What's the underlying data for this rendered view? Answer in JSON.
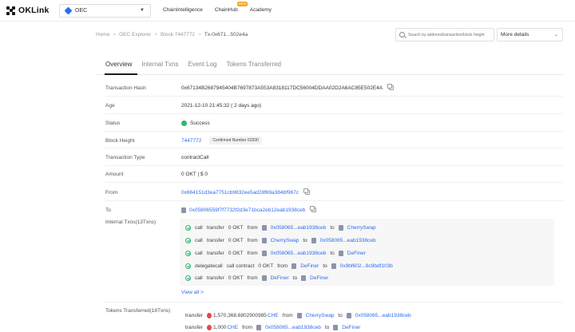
{
  "header": {
    "logo_text": "OKLink",
    "chain": "OEC",
    "nav": [
      {
        "label": "ChainIntelligence"
      },
      {
        "label": "ChainHub",
        "badge": "NEW"
      },
      {
        "label": "Academy"
      }
    ]
  },
  "breadcrumb": [
    "Home",
    "OEC Explorer",
    "Block 7447772",
    "Tx-0x671...502e4a"
  ],
  "search": {
    "placeholder": "Search by address/transaction/block height"
  },
  "more_details": "More details",
  "tabs": [
    "Overview",
    "Internal Txns",
    "Event Log",
    "Tokens Transferred"
  ],
  "details": {
    "hash_label": "Transaction Hash",
    "hash": "0x67134B2687945404B7697873A553A8318117DC56004DDAA02D2A6AC85E502E4A",
    "age_label": "Age",
    "age": "2021-12-10 21:45:32 ( 2 days ago)",
    "status_label": "Status",
    "status": "Success",
    "block_label": "Block Height",
    "block": "7447772",
    "confirm": "Confirmed Number 63200",
    "type_label": "Transaction Type",
    "type": "contractCall",
    "amount_label": "Amount",
    "amount": "0 OKT | $ 0",
    "from_label": "From",
    "from": "0x664151d3ea7751cb9832ee5ad28f69a384bf967c",
    "to_label": "To",
    "to": "0x05806559f7f7732f2d3e71bca2eb12eab1938ceb",
    "itx_label": "Internal Txns(13Txns)",
    "tt_label": "Tokens Transferred(18Txns)"
  },
  "internal_txns": [
    {
      "type": "call",
      "mid": "transfer",
      "amount": "0 OKT",
      "from_w": "from",
      "from": "0x058065...eab1938ceb",
      "to_w": "to",
      "to": "CherrySwap"
    },
    {
      "type": "call",
      "mid": "transfer",
      "amount": "0 OKT",
      "from_w": "from",
      "from": "CherrySwap",
      "to_w": "to",
      "to": "0x058065...eab1938ceb"
    },
    {
      "type": "call",
      "mid": "transfer",
      "amount": "0 OKT",
      "from_w": "from",
      "from": "0x058065...eab1938ceb",
      "to_w": "to",
      "to": "DeFiner"
    },
    {
      "type": "delegatecall",
      "mid": "call contract",
      "amount": "0 OKT",
      "from_w": "from",
      "from": "DeFiner",
      "to_w": "to",
      "to": "0x9bf602...8c9bdf103b"
    },
    {
      "type": "call",
      "mid": "transfer",
      "amount": "0 OKT",
      "from_w": "from",
      "from": "DeFiner",
      "to_w": "to",
      "to": "DeFiner"
    }
  ],
  "view_all": "View all >",
  "tokens_transferred": [
    {
      "type": "transfer",
      "amount": "1,570,368.6802900985",
      "token": "CHE",
      "from_w": "from",
      "from": "CherrySwap",
      "to_w": "to",
      "to": "0x058065...eab1938ceb"
    },
    {
      "type": "transfer",
      "amount": "1,000",
      "token": "CHE",
      "from_w": "from",
      "from": "0x058065...eab1938ceb",
      "to_w": "to",
      "to": "DeFiner"
    }
  ],
  "colors": {
    "link": "#2d6bf0",
    "success": "#2bb673",
    "badge": "#f5a623"
  }
}
